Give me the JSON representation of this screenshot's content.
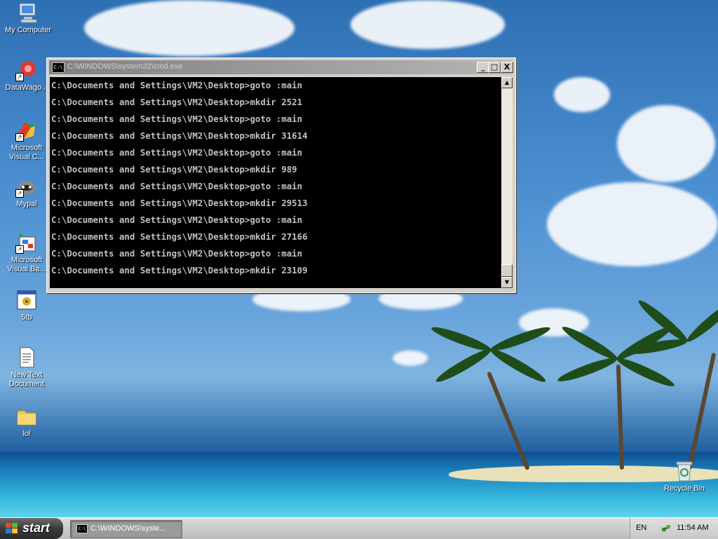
{
  "desktop": {
    "icons": [
      {
        "label": "My Computer",
        "icon": "computer-icon"
      },
      {
        "label": "DataWago...",
        "icon": "datawagon-icon"
      },
      {
        "label": "Microsoft Visual C...",
        "icon": "visual-c-icon"
      },
      {
        "label": "Mypal",
        "icon": "mypal-icon"
      },
      {
        "label": "Microsoft Visual Ba...",
        "icon": "visual-basic-icon"
      },
      {
        "label": "5tb",
        "icon": "program-window-icon"
      },
      {
        "label": "New Text Document",
        "icon": "text-document-icon"
      },
      {
        "label": "lol",
        "icon": "folder-icon"
      },
      {
        "label": "Recycle Bin",
        "icon": "recycle-bin-icon"
      }
    ]
  },
  "console_window": {
    "title": "C:\\WINDOWS\\system32\\cmd.exe",
    "icon": "cmd-icon",
    "lines": [
      "C:\\Documents and Settings\\VM2\\Desktop>goto :main",
      "C:\\Documents and Settings\\VM2\\Desktop>mkdir 2521",
      "C:\\Documents and Settings\\VM2\\Desktop>goto :main",
      "C:\\Documents and Settings\\VM2\\Desktop>mkdir 31614",
      "C:\\Documents and Settings\\VM2\\Desktop>goto :main",
      "C:\\Documents and Settings\\VM2\\Desktop>mkdir 989",
      "C:\\Documents and Settings\\VM2\\Desktop>goto :main",
      "C:\\Documents and Settings\\VM2\\Desktop>mkdir 29513",
      "C:\\Documents and Settings\\VM2\\Desktop>goto :main",
      "C:\\Documents and Settings\\VM2\\Desktop>mkdir 27166",
      "C:\\Documents and Settings\\VM2\\Desktop>goto :main",
      "C:\\Documents and Settings\\VM2\\Desktop>mkdir 23109"
    ],
    "buttons": {
      "minimize": "_",
      "maximize": "□",
      "close": "X"
    },
    "scroll_position": 1.0
  },
  "taskbar": {
    "start_label": "start",
    "tasks": [
      {
        "label": "C:\\WINDOWS\\syste...",
        "icon": "cmd-icon"
      }
    ],
    "tray": {
      "language": "EN",
      "icon": "network-icon",
      "clock": "11:54 AM"
    }
  },
  "colors": {
    "console_bg": "#000000",
    "console_text": "#c0c0c0",
    "title_inactive": "#808080"
  }
}
